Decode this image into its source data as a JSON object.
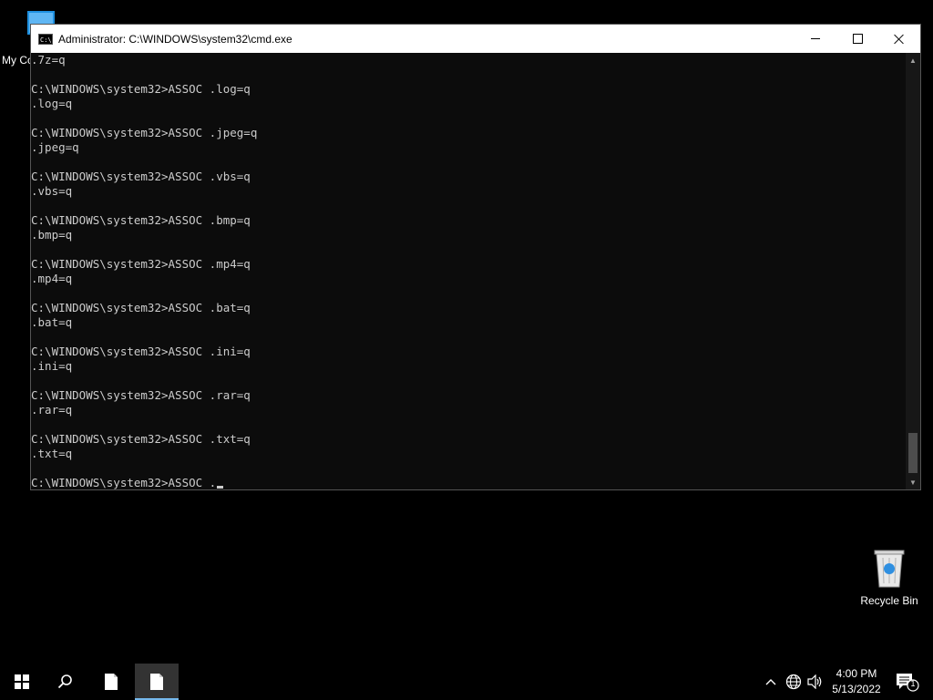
{
  "desktop": {
    "my_computer_label": "My Co",
    "recycle_bin_label": "Recycle Bin"
  },
  "window": {
    "title": "Administrator: C:\\WINDOWS\\system32\\cmd.exe"
  },
  "console": {
    "lines": [
      ".7z=q",
      "",
      "C:\\WINDOWS\\system32>ASSOC .log=q",
      ".log=q",
      "",
      "C:\\WINDOWS\\system32>ASSOC .jpeg=q",
      ".jpeg=q",
      "",
      "C:\\WINDOWS\\system32>ASSOC .vbs=q",
      ".vbs=q",
      "",
      "C:\\WINDOWS\\system32>ASSOC .bmp=q",
      ".bmp=q",
      "",
      "C:\\WINDOWS\\system32>ASSOC .mp4=q",
      ".mp4=q",
      "",
      "C:\\WINDOWS\\system32>ASSOC .bat=q",
      ".bat=q",
      "",
      "C:\\WINDOWS\\system32>ASSOC .ini=q",
      ".ini=q",
      "",
      "C:\\WINDOWS\\system32>ASSOC .rar=q",
      ".rar=q",
      "",
      "C:\\WINDOWS\\system32>ASSOC .txt=q",
      ".txt=q",
      ""
    ],
    "prompt_line": "C:\\WINDOWS\\system32>ASSOC ."
  },
  "taskbar": {
    "clock_time": "4:00 PM",
    "clock_date": "5/13/2022",
    "notification_count": "1"
  },
  "colors": {
    "console_bg": "#0c0c0c",
    "console_fg": "#cccccc",
    "taskbar_bg": "#000000",
    "accent": "#76b9ed"
  }
}
